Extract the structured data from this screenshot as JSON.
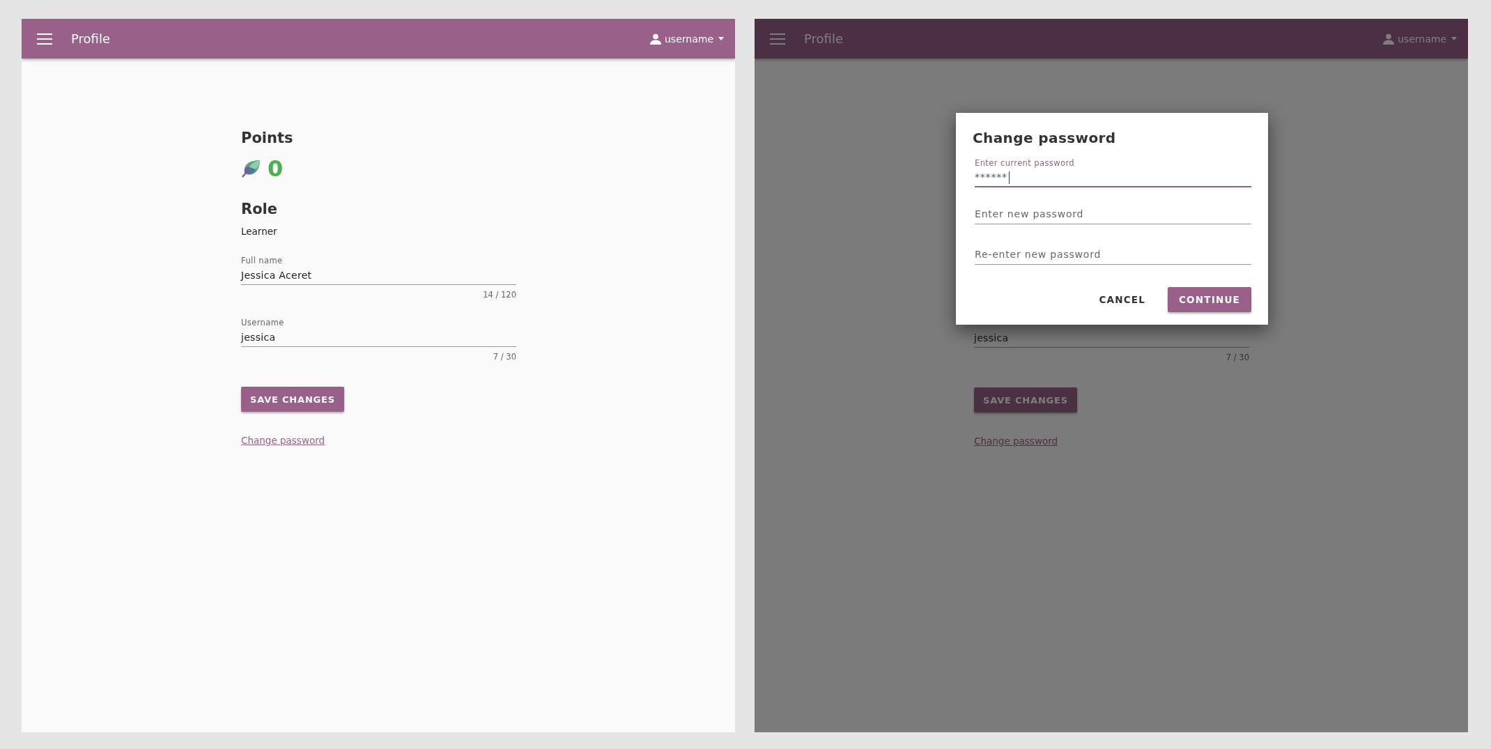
{
  "panels": [
    {
      "header": {
        "title": "Profile",
        "user": "username"
      },
      "page": {
        "points_heading": "Points",
        "points": "0",
        "role_heading": "Role",
        "role": "Learner",
        "fields": [
          {
            "label": "Full name",
            "value": "Jessica Aceret",
            "counter": "14 / 120"
          },
          {
            "label": "Username",
            "value": "jessica",
            "counter": "7 / 30"
          }
        ],
        "save_button": "SAVE CHANGES",
        "change_password_link": "Change password"
      }
    },
    {
      "header": {
        "title": "Profile",
        "user": "username"
      },
      "page": {
        "fields": [
          {
            "value": "jessica",
            "counter": "7 / 30"
          }
        ],
        "save_button": "SAVE CHANGES",
        "change_password_link": "Change password"
      },
      "dialog": {
        "title": "Change password",
        "fields": [
          {
            "label": "Enter current password",
            "value": "******",
            "focused": true
          },
          {
            "placeholder": "Enter new password",
            "focused": false
          },
          {
            "placeholder": "Re-enter new password",
            "focused": false
          }
        ],
        "buttons": [
          {
            "label": "CANCEL",
            "kind": "flat"
          },
          {
            "label": "CONTINUE",
            "kind": "raised"
          }
        ]
      }
    }
  ]
}
